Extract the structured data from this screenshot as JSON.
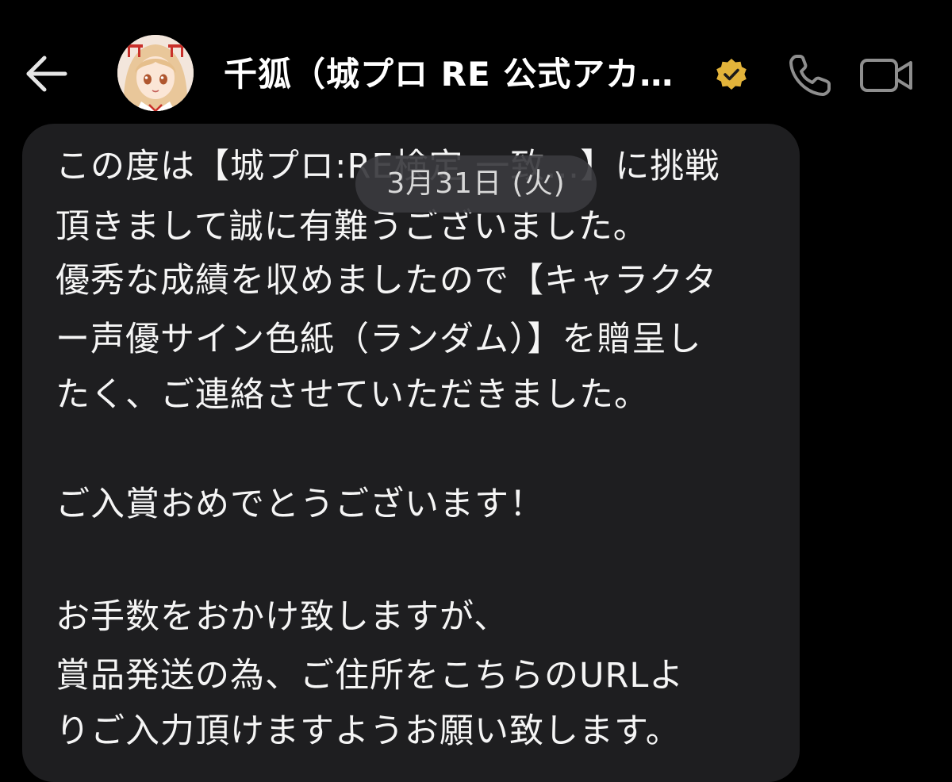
{
  "header": {
    "contact_name": "千狐（城プロ RE 公式アカウ…",
    "verified_color": "#e2b33a",
    "icons": {
      "back": "arrow-left-icon",
      "verified": "verified-badge-icon",
      "call": "phone-icon",
      "video": "video-camera-icon"
    }
  },
  "date_separator": "3月31日 (火)",
  "message": {
    "lines": [
      "この度は【城プロ:RE検定 一致…】に挑戦",
      "頂きまして誠に有難うございました。",
      "優秀な成績を収めましたので【キャラクタ",
      "ー声優サイン色紙（ランダム）】を贈呈し",
      "たく、ご連絡させていただきました。",
      "ご入賞おめでとうございます！",
      "お手数をおかけ致しますが、",
      "賞品発送の為、ご住所をこちらのURLよ",
      "りご入力頂けますようお願い致します。"
    ]
  }
}
